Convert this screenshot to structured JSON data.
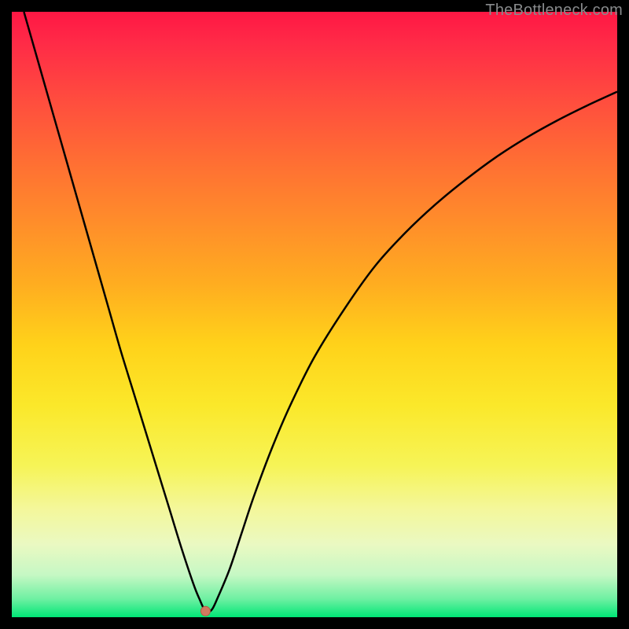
{
  "watermark": "TheBottleneck.com",
  "chart_data": {
    "type": "line",
    "title": "",
    "xlabel": "",
    "ylabel": "",
    "xlim": [
      0,
      100
    ],
    "ylim": [
      0,
      100
    ],
    "background_gradient": {
      "stops": [
        {
          "offset": 0.0,
          "color": "#ff1744"
        },
        {
          "offset": 0.05,
          "color": "#ff2a47"
        },
        {
          "offset": 0.15,
          "color": "#ff4e3e"
        },
        {
          "offset": 0.25,
          "color": "#ff6f33"
        },
        {
          "offset": 0.35,
          "color": "#ff8e2a"
        },
        {
          "offset": 0.45,
          "color": "#ffad20"
        },
        {
          "offset": 0.55,
          "color": "#ffd21a"
        },
        {
          "offset": 0.65,
          "color": "#fbe82a"
        },
        {
          "offset": 0.75,
          "color": "#f6f457"
        },
        {
          "offset": 0.82,
          "color": "#f4f79a"
        },
        {
          "offset": 0.88,
          "color": "#eaf9c2"
        },
        {
          "offset": 0.93,
          "color": "#c6f8c4"
        },
        {
          "offset": 0.97,
          "color": "#6ef0a2"
        },
        {
          "offset": 1.0,
          "color": "#00e676"
        }
      ]
    },
    "series": [
      {
        "name": "bottleneck-curve",
        "color": "#000000",
        "stroke_width_px": 2.5,
        "x": [
          2,
          4,
          6,
          8,
          10,
          12,
          14,
          16,
          18,
          20,
          22,
          24,
          26,
          28,
          30,
          31,
          32,
          33,
          34,
          36,
          38,
          40,
          43,
          46,
          50,
          55,
          60,
          65,
          70,
          75,
          80,
          85,
          90,
          95,
          100
        ],
        "values": [
          100,
          93,
          86,
          79,
          72,
          65,
          58,
          51,
          44,
          37.5,
          31,
          24.5,
          18,
          11.5,
          5.5,
          3,
          1,
          1.2,
          3.2,
          8,
          14,
          20,
          28,
          35,
          43,
          51,
          58,
          63.5,
          68.2,
          72.3,
          76,
          79.2,
          82,
          84.5,
          86.8
        ]
      }
    ],
    "marker": {
      "name": "optimal-point",
      "x": 32,
      "y": 1.0,
      "radius_px": 6,
      "fill": "#d07a60",
      "stroke": "#b55a40"
    }
  }
}
